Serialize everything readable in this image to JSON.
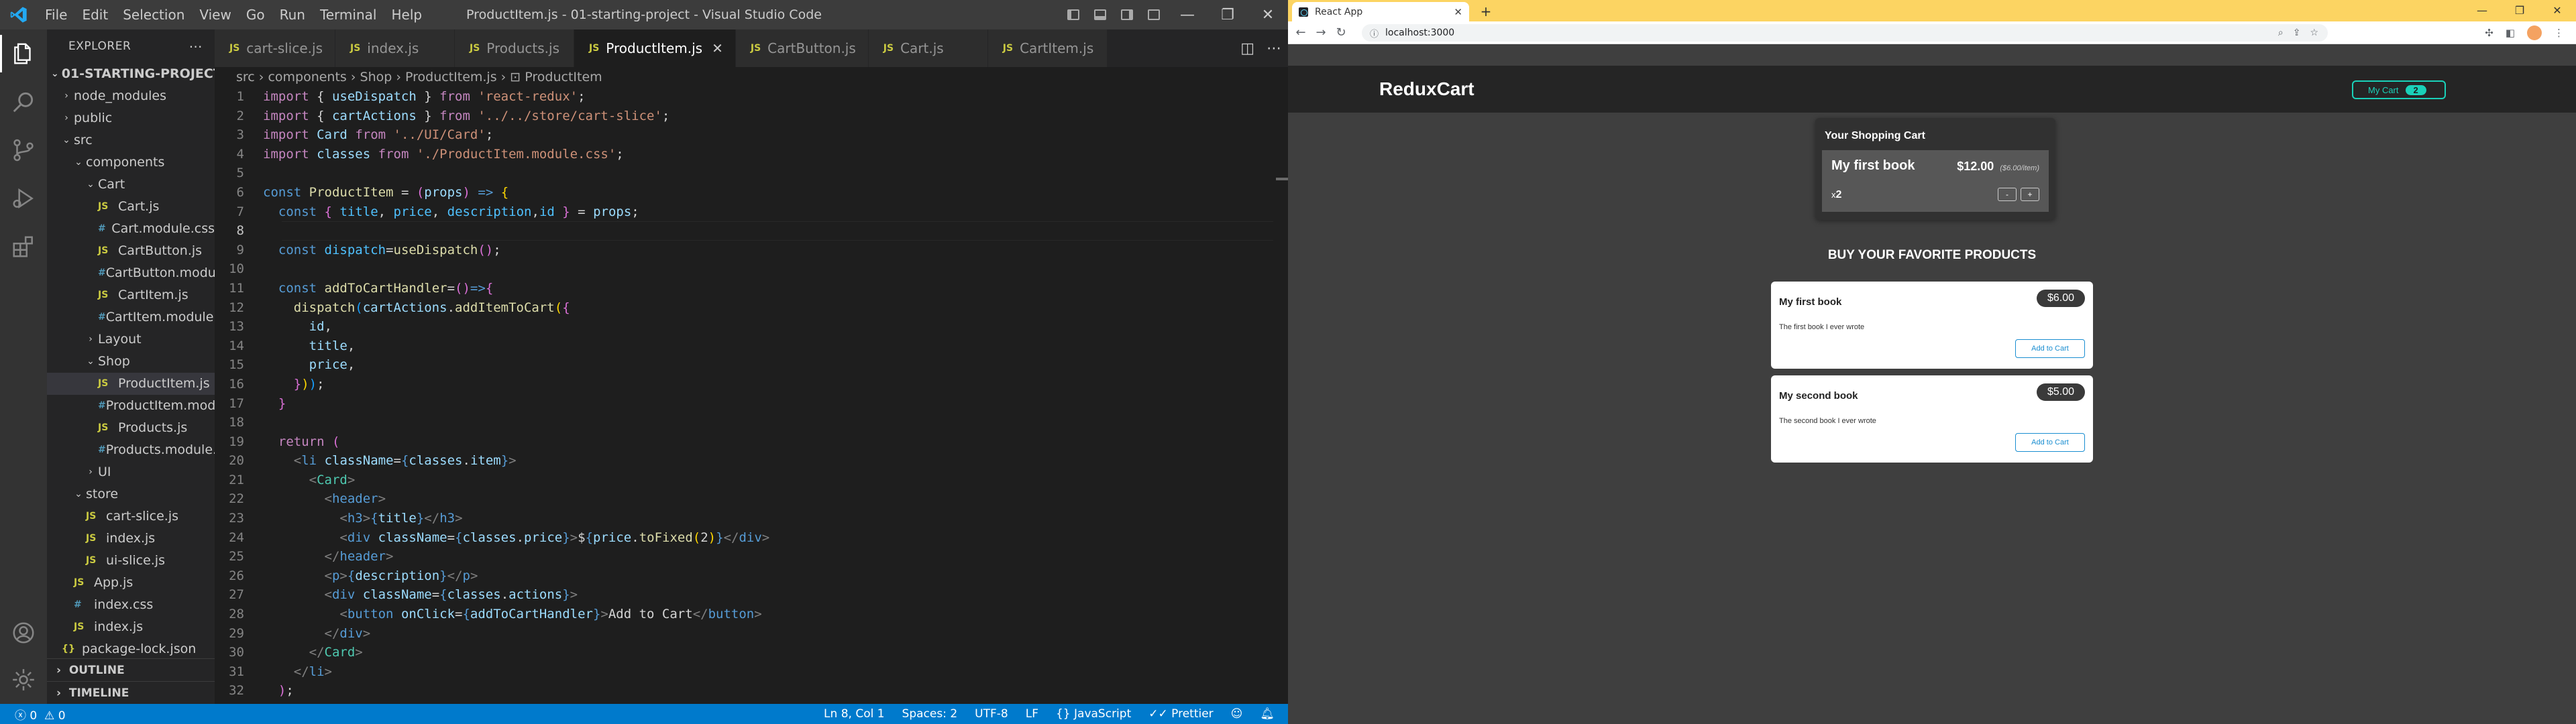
{
  "vscode": {
    "window_title": "ProductItem.js - 01-starting-project - Visual Studio Code",
    "menu": [
      "File",
      "Edit",
      "Selection",
      "View",
      "Go",
      "Run",
      "Terminal",
      "Help"
    ],
    "explorer": {
      "title": "EXPLORER",
      "project": "01-STARTING-PROJECT",
      "items": [
        {
          "label": "node_modules",
          "kind": "folder",
          "depth": 1,
          "open": false
        },
        {
          "label": "public",
          "kind": "folder",
          "depth": 1,
          "open": false
        },
        {
          "label": "src",
          "kind": "folder",
          "depth": 1,
          "open": true
        },
        {
          "label": "components",
          "kind": "folder",
          "depth": 2,
          "open": true
        },
        {
          "label": "Cart",
          "kind": "folder",
          "depth": 3,
          "open": true
        },
        {
          "label": "Cart.js",
          "kind": "js",
          "depth": 4
        },
        {
          "label": "Cart.module.css",
          "kind": "css",
          "depth": 4
        },
        {
          "label": "CartButton.js",
          "kind": "js",
          "depth": 4
        },
        {
          "label": "CartButton.modu...",
          "kind": "css",
          "depth": 4
        },
        {
          "label": "CartItem.js",
          "kind": "js",
          "depth": 4
        },
        {
          "label": "CartItem.module...",
          "kind": "css",
          "depth": 4
        },
        {
          "label": "Layout",
          "kind": "folder",
          "depth": 3,
          "open": false
        },
        {
          "label": "Shop",
          "kind": "folder",
          "depth": 3,
          "open": true
        },
        {
          "label": "ProductItem.js",
          "kind": "js",
          "depth": 4,
          "selected": true
        },
        {
          "label": "ProductItem.mod...",
          "kind": "css",
          "depth": 4
        },
        {
          "label": "Products.js",
          "kind": "js",
          "depth": 4
        },
        {
          "label": "Products.module...",
          "kind": "css",
          "depth": 4
        },
        {
          "label": "UI",
          "kind": "folder",
          "depth": 3,
          "open": false
        },
        {
          "label": "store",
          "kind": "folder",
          "depth": 2,
          "open": true
        },
        {
          "label": "cart-slice.js",
          "kind": "js",
          "depth": 3
        },
        {
          "label": "index.js",
          "kind": "js",
          "depth": 3
        },
        {
          "label": "ui-slice.js",
          "kind": "js",
          "depth": 3
        },
        {
          "label": "App.js",
          "kind": "js",
          "depth": 2
        },
        {
          "label": "index.css",
          "kind": "css",
          "depth": 2
        },
        {
          "label": "index.js",
          "kind": "js",
          "depth": 2
        },
        {
          "label": "package-lock.json",
          "kind": "json",
          "depth": 1
        }
      ],
      "outline": "OUTLINE",
      "timeline": "TIMELINE"
    },
    "tabs": [
      {
        "label": "cart-slice.js",
        "active": false
      },
      {
        "label": "index.js",
        "active": false
      },
      {
        "label": "Products.js",
        "active": false
      },
      {
        "label": "ProductItem.js",
        "active": true
      },
      {
        "label": "CartButton.js",
        "active": false
      },
      {
        "label": "Cart.js",
        "active": false
      },
      {
        "label": "CartItem.js",
        "active": false
      }
    ],
    "breadcrumb": [
      "src",
      "components",
      "Shop",
      "ProductItem.js",
      "ProductItem"
    ],
    "current_line": 8,
    "code": [
      [
        [
          "k",
          "import"
        ],
        [
          "ct",
          " { "
        ],
        [
          "v",
          "useDispatch"
        ],
        [
          "ct",
          " } "
        ],
        [
          "k",
          "from"
        ],
        [
          "ct",
          " "
        ],
        [
          "s",
          "'react-redux'"
        ],
        [
          "ct",
          ";"
        ]
      ],
      [
        [
          "k",
          "import"
        ],
        [
          "ct",
          " { "
        ],
        [
          "v",
          "cartActions"
        ],
        [
          "ct",
          " } "
        ],
        [
          "k",
          "from"
        ],
        [
          "ct",
          " "
        ],
        [
          "s",
          "'../../store/cart-slice'"
        ],
        [
          "ct",
          ";"
        ]
      ],
      [
        [
          "k",
          "import"
        ],
        [
          "ct",
          " "
        ],
        [
          "v",
          "Card"
        ],
        [
          "ct",
          " "
        ],
        [
          "k",
          "from"
        ],
        [
          "ct",
          " "
        ],
        [
          "s",
          "'../UI/Card'"
        ],
        [
          "ct",
          ";"
        ]
      ],
      [
        [
          "k",
          "import"
        ],
        [
          "ct",
          " "
        ],
        [
          "v",
          "classes"
        ],
        [
          "ct",
          " "
        ],
        [
          "k",
          "from"
        ],
        [
          "ct",
          " "
        ],
        [
          "s",
          "'./ProductItem.module.css'"
        ],
        [
          "ct",
          ";"
        ]
      ],
      [],
      [
        [
          "t",
          "const"
        ],
        [
          "ct",
          " "
        ],
        [
          "f",
          "ProductItem"
        ],
        [
          "ct",
          " = "
        ],
        [
          "p",
          "("
        ],
        [
          "v",
          "props"
        ],
        [
          "p",
          ")"
        ],
        [
          "ct",
          " "
        ],
        [
          "t",
          "=>"
        ],
        [
          "ct",
          " "
        ],
        [
          "y",
          "{"
        ]
      ],
      [
        [
          "ct",
          "  "
        ],
        [
          "t",
          "const"
        ],
        [
          "ct",
          " "
        ],
        [
          "p",
          "{"
        ],
        [
          "ct",
          " "
        ],
        [
          "c",
          "title"
        ],
        [
          "ct",
          ", "
        ],
        [
          "c",
          "price"
        ],
        [
          "ct",
          ", "
        ],
        [
          "c",
          "description"
        ],
        [
          "ct",
          ","
        ],
        [
          "c",
          "id"
        ],
        [
          "ct",
          " "
        ],
        [
          "p",
          "}"
        ],
        [
          "ct",
          " = "
        ],
        [
          "v",
          "props"
        ],
        [
          "ct",
          ";"
        ]
      ],
      [],
      [
        [
          "ct",
          "  "
        ],
        [
          "t",
          "const"
        ],
        [
          "ct",
          " "
        ],
        [
          "c",
          "dispatch"
        ],
        [
          "ct",
          "="
        ],
        [
          "f",
          "useDispatch"
        ],
        [
          "p",
          "()"
        ],
        [
          "ct",
          ";"
        ]
      ],
      [],
      [
        [
          "ct",
          "  "
        ],
        [
          "t",
          "const"
        ],
        [
          "ct",
          " "
        ],
        [
          "f",
          "addToCartHandler"
        ],
        [
          "ct",
          "="
        ],
        [
          "p",
          "()"
        ],
        [
          "t",
          "=>"
        ],
        [
          "p",
          "{"
        ]
      ],
      [
        [
          "ct",
          "    "
        ],
        [
          "f",
          "dispatch"
        ],
        [
          "b",
          "("
        ],
        [
          "v",
          "cartActions"
        ],
        [
          "ct",
          "."
        ],
        [
          "f",
          "addItemToCart"
        ],
        [
          "y",
          "("
        ],
        [
          "p",
          "{"
        ]
      ],
      [
        [
          "ct",
          "      "
        ],
        [
          "v",
          "id"
        ],
        [
          "ct",
          ","
        ]
      ],
      [
        [
          "ct",
          "      "
        ],
        [
          "v",
          "title"
        ],
        [
          "ct",
          ","
        ]
      ],
      [
        [
          "ct",
          "      "
        ],
        [
          "v",
          "price"
        ],
        [
          "ct",
          ","
        ]
      ],
      [
        [
          "ct",
          "    "
        ],
        [
          "p",
          "}"
        ],
        [
          "y",
          ")"
        ],
        [
          "b",
          ")"
        ],
        [
          "ct",
          ";"
        ]
      ],
      [
        [
          "ct",
          "  "
        ],
        [
          "p",
          "}"
        ]
      ],
      [],
      [
        [
          "ct",
          "  "
        ],
        [
          "k",
          "return"
        ],
        [
          "ct",
          " "
        ],
        [
          "p",
          "("
        ]
      ],
      [
        [
          "ct",
          "    "
        ],
        [
          "g",
          "<"
        ],
        [
          "t",
          "li"
        ],
        [
          "ct",
          " "
        ],
        [
          "v",
          "className"
        ],
        [
          "ct",
          "="
        ],
        [
          "t",
          "{"
        ],
        [
          "v",
          "classes"
        ],
        [
          "ct",
          "."
        ],
        [
          "v",
          "item"
        ],
        [
          "t",
          "}"
        ],
        [
          "g",
          ">"
        ]
      ],
      [
        [
          "ct",
          "      "
        ],
        [
          "g",
          "<"
        ],
        [
          "ty",
          "Card"
        ],
        [
          "g",
          ">"
        ]
      ],
      [
        [
          "ct",
          "        "
        ],
        [
          "g",
          "<"
        ],
        [
          "t",
          "header"
        ],
        [
          "g",
          ">"
        ]
      ],
      [
        [
          "ct",
          "          "
        ],
        [
          "g",
          "<"
        ],
        [
          "t",
          "h3"
        ],
        [
          "g",
          ">"
        ],
        [
          "t",
          "{"
        ],
        [
          "v",
          "title"
        ],
        [
          "t",
          "}"
        ],
        [
          "g",
          "</"
        ],
        [
          "t",
          "h3"
        ],
        [
          "g",
          ">"
        ]
      ],
      [
        [
          "ct",
          "          "
        ],
        [
          "g",
          "<"
        ],
        [
          "t",
          "div"
        ],
        [
          "ct",
          " "
        ],
        [
          "v",
          "className"
        ],
        [
          "ct",
          "="
        ],
        [
          "t",
          "{"
        ],
        [
          "v",
          "classes"
        ],
        [
          "ct",
          "."
        ],
        [
          "v",
          "price"
        ],
        [
          "t",
          "}"
        ],
        [
          "g",
          ">"
        ],
        [
          "ct",
          "$"
        ],
        [
          "t",
          "{"
        ],
        [
          "v",
          "price"
        ],
        [
          "ct",
          "."
        ],
        [
          "f",
          "toFixed"
        ],
        [
          "y",
          "("
        ],
        [
          "ct",
          "2"
        ],
        [
          "y",
          ")"
        ],
        [
          "t",
          "}"
        ],
        [
          "g",
          "</"
        ],
        [
          "t",
          "div"
        ],
        [
          "g",
          ">"
        ]
      ],
      [
        [
          "ct",
          "        "
        ],
        [
          "g",
          "</"
        ],
        [
          "t",
          "header"
        ],
        [
          "g",
          ">"
        ]
      ],
      [
        [
          "ct",
          "        "
        ],
        [
          "g",
          "<"
        ],
        [
          "t",
          "p"
        ],
        [
          "g",
          ">"
        ],
        [
          "t",
          "{"
        ],
        [
          "v",
          "description"
        ],
        [
          "t",
          "}"
        ],
        [
          "g",
          "</"
        ],
        [
          "t",
          "p"
        ],
        [
          "g",
          ">"
        ]
      ],
      [
        [
          "ct",
          "        "
        ],
        [
          "g",
          "<"
        ],
        [
          "t",
          "div"
        ],
        [
          "ct",
          " "
        ],
        [
          "v",
          "className"
        ],
        [
          "ct",
          "="
        ],
        [
          "t",
          "{"
        ],
        [
          "v",
          "classes"
        ],
        [
          "ct",
          "."
        ],
        [
          "v",
          "actions"
        ],
        [
          "t",
          "}"
        ],
        [
          "g",
          ">"
        ]
      ],
      [
        [
          "ct",
          "          "
        ],
        [
          "g",
          "<"
        ],
        [
          "t",
          "button"
        ],
        [
          "ct",
          " "
        ],
        [
          "v",
          "onClick"
        ],
        [
          "ct",
          "="
        ],
        [
          "t",
          "{"
        ],
        [
          "v",
          "addToCartHandler"
        ],
        [
          "t",
          "}"
        ],
        [
          "g",
          ">"
        ],
        [
          "ct",
          "Add to Cart"
        ],
        [
          "g",
          "</"
        ],
        [
          "t",
          "button"
        ],
        [
          "g",
          ">"
        ]
      ],
      [
        [
          "ct",
          "        "
        ],
        [
          "g",
          "</"
        ],
        [
          "t",
          "div"
        ],
        [
          "g",
          ">"
        ]
      ],
      [
        [
          "ct",
          "      "
        ],
        [
          "g",
          "</"
        ],
        [
          "ty",
          "Card"
        ],
        [
          "g",
          ">"
        ]
      ],
      [
        [
          "ct",
          "    "
        ],
        [
          "g",
          "</"
        ],
        [
          "t",
          "li"
        ],
        [
          "g",
          ">"
        ]
      ],
      [
        [
          "ct",
          "  "
        ],
        [
          "p",
          ")"
        ],
        [
          "ct",
          ";"
        ]
      ]
    ],
    "status": {
      "errors": "0",
      "warnings": "0",
      "position": "Ln 8, Col 1",
      "spaces": "Spaces: 2",
      "encoding": "UTF-8",
      "eol": "LF",
      "language": "JavaScript",
      "formatter": "Prettier"
    }
  },
  "browser": {
    "tab_title": "React App",
    "url": "localhost:3000",
    "app": {
      "logo": "ReduxCart",
      "cart_button_label": "My Cart",
      "cart_badge": "2",
      "cart": {
        "title": "Your Shopping Cart",
        "items": [
          {
            "title": "My first book",
            "total": "$12.00",
            "unit": "($6.00/item)",
            "qty_prefix": "x",
            "qty": "2",
            "minus": "-",
            "plus": "+"
          }
        ]
      },
      "products_title": "BUY YOUR FAVORITE PRODUCTS",
      "products": [
        {
          "title": "My first book",
          "price": "$6.00",
          "description": "The first book I ever wrote",
          "button": "Add to Cart"
        },
        {
          "title": "My second book",
          "price": "$5.00",
          "description": "The second book I ever wrote",
          "button": "Add to Cart"
        }
      ]
    }
  },
  "colors": {
    "vscode_status": "#007acc",
    "accent": "#1ad1b9",
    "chrome_tab_strip": "#fcd462"
  }
}
